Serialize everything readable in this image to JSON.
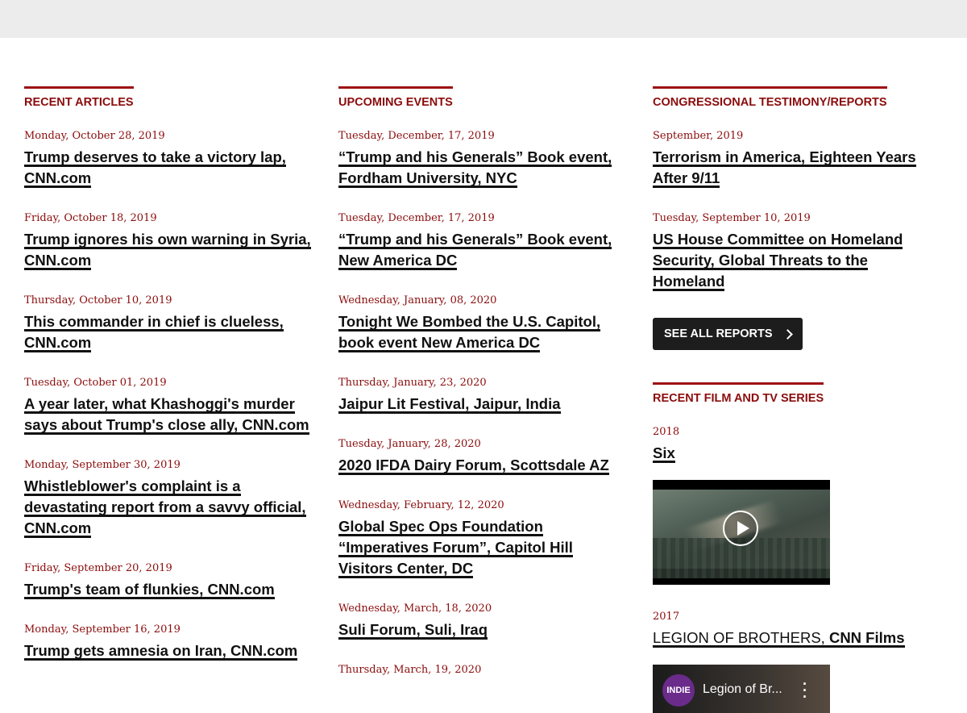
{
  "recent_articles": {
    "heading": "RECENT ARTICLES",
    "items": [
      {
        "date": "Monday, October 28, 2019",
        "lines": [
          "Trump deserves to take a victory lap,",
          "CNN.com"
        ]
      },
      {
        "date": "Friday, October 18, 2019",
        "lines": [
          "Trump ignores his own warning in Syria,",
          "CNN.com"
        ]
      },
      {
        "date": "Thursday, October 10, 2019",
        "lines": [
          "This commander in chief is clueless,",
          "CNN.com"
        ]
      },
      {
        "date": "Tuesday, October 01, 2019",
        "lines": [
          "A year later, what Khashoggi's murder",
          "says about Trump's close ally, CNN.com"
        ]
      },
      {
        "date": "Monday, September 30, 2019",
        "lines": [
          "Whistleblower's complaint is a",
          "devastating report from a savvy official,",
          "CNN.com"
        ]
      },
      {
        "date": "Friday, September 20, 2019",
        "lines": [
          "Trump's team of flunkies, CNN.com"
        ]
      },
      {
        "date": "Monday, September 16, 2019",
        "lines": [
          "Trump gets amnesia on Iran, CNN.com"
        ]
      }
    ]
  },
  "upcoming_events": {
    "heading": "UPCOMING EVENTS",
    "items": [
      {
        "date": "Tuesday, December, 17, 2019",
        "lines": [
          "“Trump and his Generals” Book event,",
          "Fordham University, NYC"
        ]
      },
      {
        "date": "Tuesday, December, 17, 2019",
        "lines": [
          "“Trump and his Generals” Book event,",
          "New America DC"
        ]
      },
      {
        "date": "Wednesday, January, 08, 2020",
        "lines": [
          "Tonight We Bombed the U.S. Capitol,",
          "book event New America DC"
        ]
      },
      {
        "date": "Thursday, January, 23, 2020",
        "lines": [
          "Jaipur Lit Festival, Jaipur, India"
        ]
      },
      {
        "date": "Tuesday, January, 28, 2020",
        "lines": [
          "2020 IFDA Dairy Forum, Scottsdale AZ"
        ]
      },
      {
        "date": "Wednesday, February, 12, 2020",
        "lines": [
          "Global Spec Ops Foundation",
          "“Imperatives Forum”, Capitol Hill",
          "Visitors Center, DC"
        ]
      },
      {
        "date": "Wednesday, March, 18, 2020",
        "lines": [
          "Suli Forum, Suli, Iraq"
        ]
      },
      {
        "date": "Thursday, March, 19, 2020",
        "lines": []
      }
    ]
  },
  "congressional": {
    "heading": "CONGRESSIONAL TESTIMONY/REPORTS",
    "items": [
      {
        "date": "September, 2019",
        "lines": [
          "Terrorism in America, Eighteen Years",
          "After 9/11"
        ]
      },
      {
        "date": "Tuesday, September 10, 2019",
        "lines": [
          "US House Committee on Homeland",
          "Security, Global Threats to the",
          "Homeland"
        ]
      }
    ],
    "button_label": "SEE ALL REPORTS"
  },
  "film_tv": {
    "heading": "RECENT FILM AND TV SERIES",
    "items": [
      {
        "year": "2018",
        "title": "Six"
      },
      {
        "year": "2017",
        "title_light": "LEGION OF BROTHERS, ",
        "title_bold": "CNN Films"
      }
    ],
    "embed": {
      "channel_logo": "INDIE",
      "title": "Legion of Br..."
    }
  },
  "colors": {
    "accent": "#8b0c0c",
    "rule": "#9e1111",
    "button_bg": "#1d1d1d",
    "topbar": "#ececec"
  }
}
